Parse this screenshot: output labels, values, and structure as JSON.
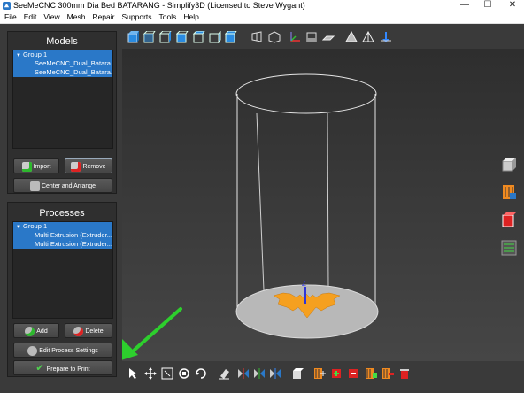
{
  "window": {
    "title": "SeeMeCNC 300mm Dia Bed BATARANG - Simplify3D (Licensed to Steve Wygant)",
    "minimize": "—",
    "maximize": "☐",
    "close": "✕"
  },
  "menu": [
    "File",
    "Edit",
    "View",
    "Mesh",
    "Repair",
    "Supports",
    "Tools",
    "Help"
  ],
  "models": {
    "title": "Models",
    "group": "Group 1",
    "items": [
      "SeeMeCNC_Dual_Batara...",
      "SeeMeCNC_Dual_Batara..."
    ],
    "import_label": "Import",
    "remove_label": "Remove",
    "center_label": "Center and Arrange"
  },
  "processes": {
    "title": "Processes",
    "group": "Group 1",
    "items": [
      "Multi Extrusion (Extruder...",
      "Multi Extrusion (Extruder..."
    ],
    "add_label": "Add",
    "delete_label": "Delete",
    "edit_label": "Edit Process Settings",
    "prepare_label": "Prepare to Print"
  },
  "viewport": {
    "axis_label": "Z",
    "build_plate_color": "#b8b8b8",
    "model_color": "#f5a020"
  },
  "colors": {
    "accent": "#2a78c8",
    "arrow": "#2dcf2d"
  }
}
